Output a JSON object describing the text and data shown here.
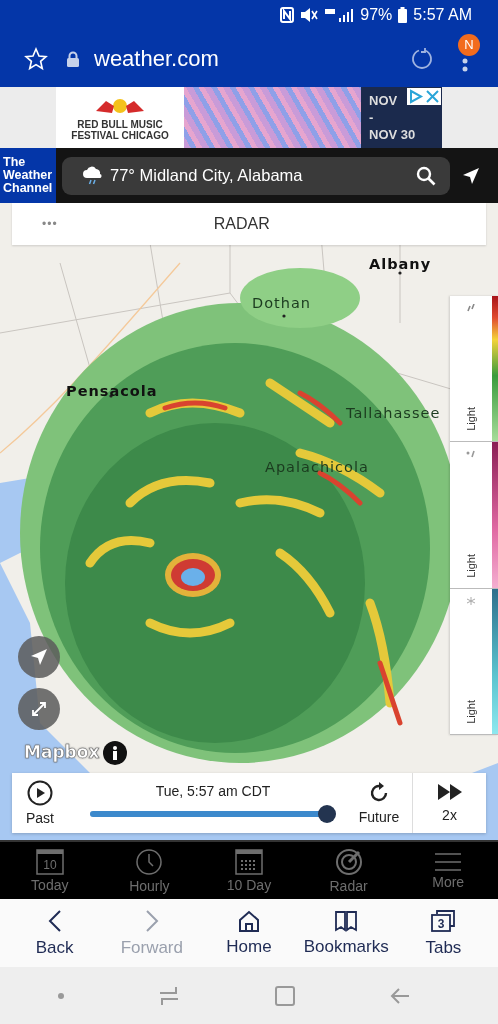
{
  "status_bar": {
    "battery": "97%",
    "time": "5:57 AM"
  },
  "browser": {
    "url": "weather.com",
    "profile_badge": "N"
  },
  "ad": {
    "brand": "RED BULL MUSIC FESTIVAL CHICAGO",
    "date_top": "NOV",
    "date_dash": "-",
    "date_end": "NOV 30"
  },
  "header": {
    "logo": "The Weather Channel",
    "location": "77° Midland City, Alabama"
  },
  "radar_card": {
    "menu": "•••",
    "title": "RADAR"
  },
  "map": {
    "cities": [
      {
        "name": "Albany",
        "kind": "dark"
      },
      {
        "name": "Dothan",
        "kind": "overlay"
      },
      {
        "name": "Pensacola",
        "kind": "dark"
      },
      {
        "name": "Tallahassee",
        "kind": "overlay"
      },
      {
        "name": "Apalachicola",
        "kind": "overlay"
      }
    ],
    "attribution": "Mapbox"
  },
  "legend": [
    {
      "kind": "rain",
      "label": "Light"
    },
    {
      "kind": "mix",
      "label": "Light"
    },
    {
      "kind": "snow",
      "label": "Light"
    }
  ],
  "timeline": {
    "play_label": "Past",
    "time": "Tue, 5:57 am CDT",
    "level": 1,
    "future_label": "Future",
    "speed": "2x"
  },
  "app_nav": [
    {
      "kind": "today",
      "label": "Today",
      "day": "10",
      "selected": false
    },
    {
      "kind": "hourly",
      "label": "Hourly",
      "selected": false
    },
    {
      "kind": "tenday",
      "label": "10 Day",
      "selected": false
    },
    {
      "kind": "radar",
      "label": "Radar",
      "selected": false
    },
    {
      "kind": "more",
      "label": "More",
      "selected": false
    }
  ],
  "toolbar": [
    {
      "kind": "back",
      "label": "Back",
      "disabled": false
    },
    {
      "kind": "forward",
      "label": "Forward",
      "disabled": true
    },
    {
      "kind": "home",
      "label": "Home",
      "disabled": false
    },
    {
      "kind": "bookmarks",
      "label": "Bookmarks",
      "disabled": false
    },
    {
      "kind": "tabs",
      "label": "Tabs",
      "count": "3",
      "disabled": false
    }
  ]
}
